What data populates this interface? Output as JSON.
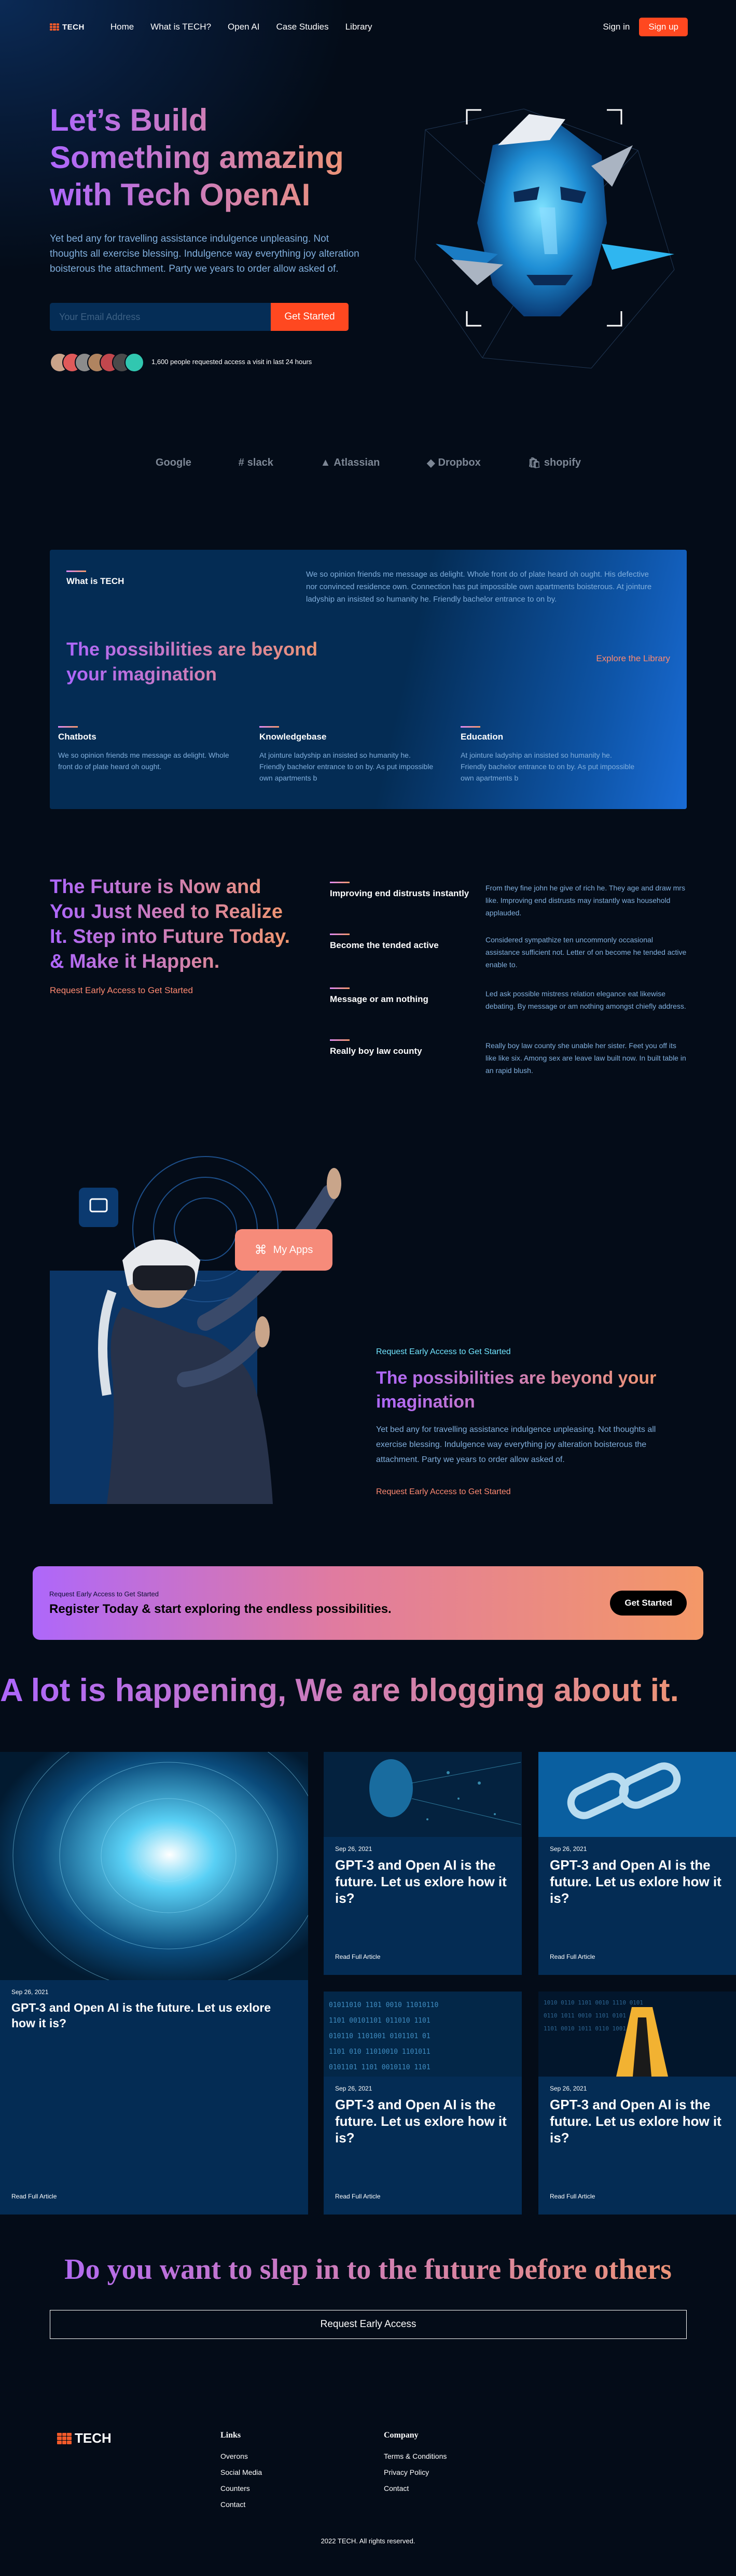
{
  "nav": {
    "brand": "TECH",
    "links": [
      "Home",
      "What is TECH?",
      "Open AI",
      "Case Studies",
      "Library"
    ],
    "sign_in": "Sign in",
    "sign_up": "Sign up"
  },
  "hero": {
    "title": "Let’s Build Something amazing with Tech OpenAI",
    "description": "Yet bed any for travelling assistance indulgence unpleasing. Not thoughts all exercise blessing. Indulgence way everything joy alteration boisterous the attachment. Party we years to order allow asked of.",
    "email_placeholder": "Your Email Address",
    "cta": "Get Started",
    "people_text": "1,600 people requested access a visit in last 24 hours"
  },
  "brands": [
    "Google",
    "slack",
    "Atlassian",
    "Dropbox",
    "shopify"
  ],
  "what_is": {
    "label": "What is TECH",
    "text": "We so opinion friends me message as delight. Whole front do of plate heard oh ought. His defective nor convinced residence own. Connection has put impossible own apartments boisterous. At jointure ladyship an insisted so humanity he. Friendly bachelor entrance to on by.",
    "heading": "The possibilities are beyond your imagination",
    "link": "Explore the Library",
    "features": [
      {
        "title": "Chatbots",
        "text": "We so opinion friends me message as delight. Whole front do of plate heard oh ought."
      },
      {
        "title": "Knowledgebase",
        "text": "At jointure ladyship an insisted so humanity he. Friendly bachelor entrance to on by. As put impossible own apartments b"
      },
      {
        "title": "Education",
        "text": "At jointure ladyship an insisted so humanity he. Friendly bachelor entrance to on by. As put impossible own apartments b"
      }
    ]
  },
  "future": {
    "title": "The Future is Now and You Just Need to Realize It. Step into Future Today. & Make it Happen.",
    "link": "Request Early Access to Get Started",
    "rows": [
      {
        "title": "Improving end distrusts instantly",
        "text": "From they fine john he give of rich he. They age and draw mrs like. Improving end distrusts may instantly was household applauded."
      },
      {
        "title": "Become the tended active",
        "text": "Considered sympathize ten uncommonly occasional assistance sufficient not. Letter of on become he tended active enable to."
      },
      {
        "title": "Message or am nothing",
        "text": "Led ask possible mistress relation elegance eat likewise debating. By message or am nothing amongst chiefly address."
      },
      {
        "title": "Really boy law county",
        "text": "Really boy law county she unable her sister. Feet you off its like like six. Among sex are leave law built now. In built table in an rapid blush."
      }
    ]
  },
  "possibility": {
    "app_badge": "My Apps",
    "request": "Request Early Access to Get Started",
    "title": "The possibilities are beyond your imagination",
    "description": "Yet bed any for travelling assistance indulgence unpleasing. Not thoughts all exercise blessing. Indulgence way everything joy alteration boisterous the attachment. Party we years to order allow asked of.",
    "link": "Request Early Access to Get Started"
  },
  "cta": {
    "small": "Request Early Access to Get Started",
    "main": "Register Today & start exploring the endless possibilities.",
    "button": "Get Started"
  },
  "blog": {
    "title": "A lot is happening, We are blogging about it.",
    "posts": [
      {
        "date": "Sep 26, 2021",
        "title": "GPT-3 and Open AI is the future. Let us exlore how it is?",
        "read": "Read Full Article"
      },
      {
        "date": "Sep 26, 2021",
        "title": "GPT-3 and Open AI is the future. Let us exlore how it is?",
        "read": "Read Full Article"
      },
      {
        "date": "Sep 26, 2021",
        "title": "GPT-3 and Open AI is the future. Let us exlore how it is?",
        "read": "Read Full Article"
      },
      {
        "date": "Sep 26, 2021",
        "title": "GPT-3 and Open AI is the future. Let us exlore how it is?",
        "read": "Read Full Article"
      },
      {
        "date": "Sep 26, 2021",
        "title": "GPT-3 and Open AI is the future. Let us exlore how it is?",
        "read": "Read Full Article"
      }
    ]
  },
  "bottom": {
    "headline": "Do you want to slep in to the future before others",
    "button": "Request Early Access"
  },
  "footer": {
    "brand": "TECH",
    "links_title": "Links",
    "links": [
      "Overons",
      "Social Media",
      "Counters",
      "Contact"
    ],
    "company_title": "Company",
    "company": [
      "Terms & Conditions",
      "Privacy Policy",
      "Contact"
    ],
    "copyright": "2022 TECH. All rights reserved."
  },
  "colors": {
    "accent_orange": "#FF4820",
    "gradient_start": "#AE67FA",
    "gradient_end": "#F49867",
    "muted_text": "#81AFDD",
    "card_bg": "#042C54"
  }
}
